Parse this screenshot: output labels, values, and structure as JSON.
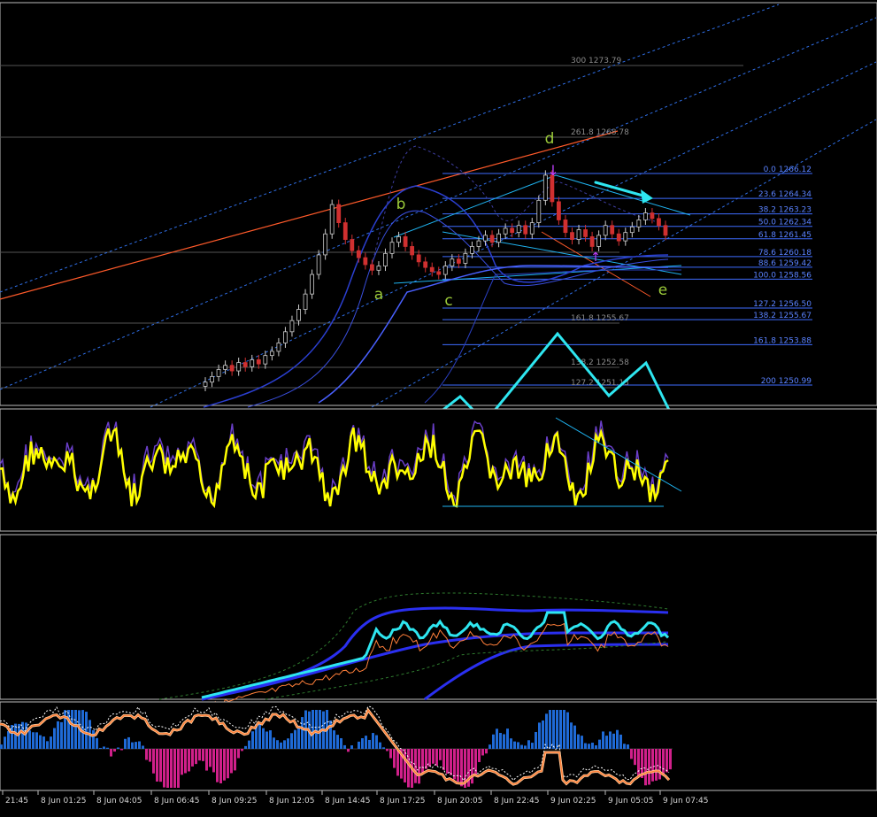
{
  "chart_data": {
    "type": "line",
    "title": "",
    "fib_levels_right": [
      {
        "label": "0.0 1266.12",
        "price": 1266.12
      },
      {
        "label": "23.6 1264.34",
        "price": 1264.34
      },
      {
        "label": "38.2 1263.23",
        "price": 1263.23
      },
      {
        "label": "50.0 1262.34",
        "price": 1262.34
      },
      {
        "label": "61.8 1261.45",
        "price": 1261.45
      },
      {
        "label": "78.6 1260.18",
        "price": 1260.18
      },
      {
        "label": "88.6 1259.42",
        "price": 1259.42
      },
      {
        "label": "100.0 1258.56",
        "price": 1258.56
      },
      {
        "label": "127.2 1256.50",
        "price": 1256.5
      },
      {
        "label": "138.2 1255.67",
        "price": 1255.67
      },
      {
        "label": "161.8 1253.88",
        "price": 1253.88
      },
      {
        "label": "200 1250.99",
        "price": 1250.99
      }
    ],
    "fib_levels_mid": [
      {
        "label": "300 1273.79",
        "price": 1273.79
      },
      {
        "label": "261.8 1268.78",
        "price": 1268.78
      },
      {
        "label": "161.8 1255.67",
        "price": 1255.67
      },
      {
        "label": "138.2 1252.58",
        "price": 1252.58
      },
      {
        "label": "127.2 1251.13",
        "price": 1251.13
      }
    ],
    "wave_labels": [
      "a",
      "b",
      "c",
      "d",
      "e"
    ],
    "x_tick_labels": [
      "21:45",
      "8 Jun 01:25",
      "8 Jun 04:05",
      "8 Jun 06:45",
      "8 Jun 09:25",
      "8 Jun 12:05",
      "8 Jun 14:45",
      "8 Jun 17:25",
      "8 Jun 20:05",
      "8 Jun 22:45",
      "9 Jun 02:25",
      "9 Jun 05:05",
      "9 Jun 07:45"
    ],
    "price_close": [
      1251.2,
      1251.6,
      1252.1,
      1252.4,
      1252.0,
      1252.6,
      1252.3,
      1252.8,
      1252.5,
      1253.1,
      1253.4,
      1254.0,
      1254.8,
      1255.6,
      1256.4,
      1257.5,
      1258.9,
      1260.3,
      1261.8,
      1263.9,
      1262.6,
      1261.4,
      1260.6,
      1260.1,
      1259.6,
      1259.2,
      1259.5,
      1260.4,
      1261.2,
      1261.6,
      1260.9,
      1260.3,
      1259.8,
      1259.4,
      1259.1,
      1258.9,
      1259.5,
      1260.0,
      1259.7,
      1260.4,
      1260.9,
      1261.3,
      1261.7,
      1261.2,
      1261.8,
      1262.2,
      1261.9,
      1262.4,
      1261.8,
      1262.6,
      1264.2,
      1266.0,
      1264.1,
      1262.8,
      1261.9,
      1261.4,
      1262.1,
      1261.6,
      1260.9,
      1261.7,
      1262.4,
      1261.8,
      1261.3,
      1261.9,
      1262.3,
      1262.8,
      1263.3,
      1262.9,
      1262.4,
      1261.7
    ]
  },
  "colors": {
    "background": "#000000",
    "grid": "#4a4a4a",
    "fib_blue": "#3e6cff",
    "fib_gray": "#7a7a7a",
    "trend_red": "#ff5a2a",
    "channel_blue": "#3a7bff",
    "wave_green": "#9ccb3a",
    "arrow_cyan": "#2ee6f0",
    "oscillator_yellow": "#ffff00",
    "oscillator_purple": "#6a3fc8",
    "histogram_blue": "#1f6ad6",
    "histogram_magenta": "#d0208a",
    "line_orange": "#ff7f3a"
  }
}
